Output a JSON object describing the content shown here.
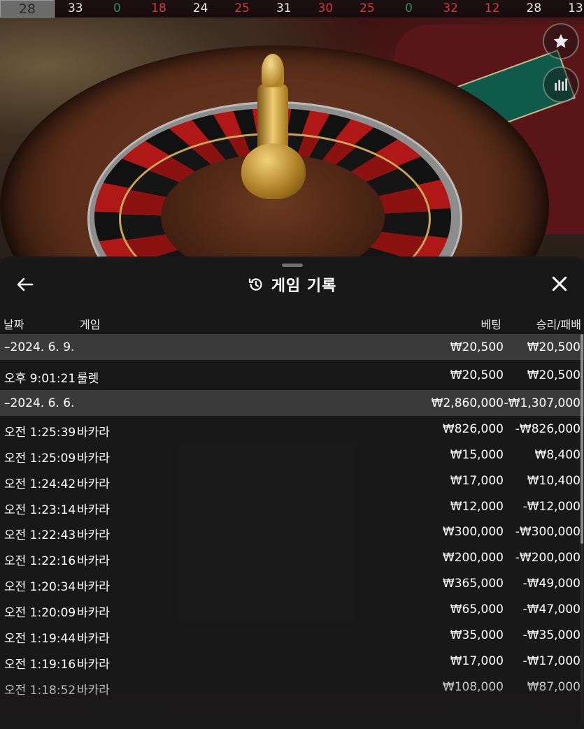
{
  "history_strip": {
    "numbers": [
      {
        "value": "28",
        "color": "#ffffff"
      },
      {
        "value": "33",
        "color": "#e6e6e6"
      },
      {
        "value": "0",
        "color": "#2e8b57"
      },
      {
        "value": "18",
        "color": "#d23a3a"
      },
      {
        "value": "24",
        "color": "#e6e6e6"
      },
      {
        "value": "25",
        "color": "#d23a3a"
      },
      {
        "value": "31",
        "color": "#e6e6e6"
      },
      {
        "value": "30",
        "color": "#d23a3a"
      },
      {
        "value": "25",
        "color": "#d23a3a"
      },
      {
        "value": "0",
        "color": "#2e8b57"
      },
      {
        "value": "32",
        "color": "#d23a3a"
      },
      {
        "value": "12",
        "color": "#d23a3a"
      },
      {
        "value": "28",
        "color": "#e6e6e6"
      },
      {
        "value": "13",
        "color": "#e6e6e6"
      }
    ]
  },
  "side_buttons": {
    "favorite_icon": "star-icon",
    "stats_icon": "bar-chart-icon"
  },
  "panel": {
    "title": "게임 기록",
    "title_icon": "history-icon",
    "back_icon": "arrow-left-icon",
    "close_icon": "close-icon",
    "columns": {
      "date": "날짜",
      "game": "게임",
      "bet": "베팅",
      "result": "승리/패배"
    },
    "groups": [
      {
        "date": "–2024. 6. 9.",
        "bet_total": "₩20,500",
        "result_total": "₩20,500",
        "rows": [
          {
            "time": "오후 9:01:21",
            "game": "룰렛",
            "bet": "₩20,500",
            "result": "₩20,500"
          }
        ]
      },
      {
        "date": "–2024. 6. 6.",
        "bet_total": "₩2,860,000",
        "result_total": "-₩1,307,000",
        "rows": [
          {
            "time": "오전 1:25:39",
            "game": "바카라",
            "bet": "₩826,000",
            "result": "-₩826,000"
          },
          {
            "time": "오전 1:25:09",
            "game": "바카라",
            "bet": "₩15,000",
            "result": "₩8,400"
          },
          {
            "time": "오전 1:24:42",
            "game": "바카라",
            "bet": "₩17,000",
            "result": "₩10,400"
          },
          {
            "time": "오전 1:23:14",
            "game": "바카라",
            "bet": "₩12,000",
            "result": "-₩12,000"
          },
          {
            "time": "오전 1:22:43",
            "game": "바카라",
            "bet": "₩300,000",
            "result": "-₩300,000"
          },
          {
            "time": "오전 1:22:16",
            "game": "바카라",
            "bet": "₩200,000",
            "result": "-₩200,000"
          },
          {
            "time": "오전 1:20:34",
            "game": "바카라",
            "bet": "₩365,000",
            "result": "-₩49,000"
          },
          {
            "time": "오전 1:20:09",
            "game": "바카라",
            "bet": "₩65,000",
            "result": "-₩47,000"
          },
          {
            "time": "오전 1:19:44",
            "game": "바카라",
            "bet": "₩35,000",
            "result": "-₩35,000"
          },
          {
            "time": "오전 1:19:16",
            "game": "바카라",
            "bet": "₩17,000",
            "result": "-₩17,000"
          },
          {
            "time": "오전 1:18:52",
            "game": "바카라",
            "bet": "₩108,000",
            "result": "₩87,000"
          }
        ]
      }
    ]
  }
}
